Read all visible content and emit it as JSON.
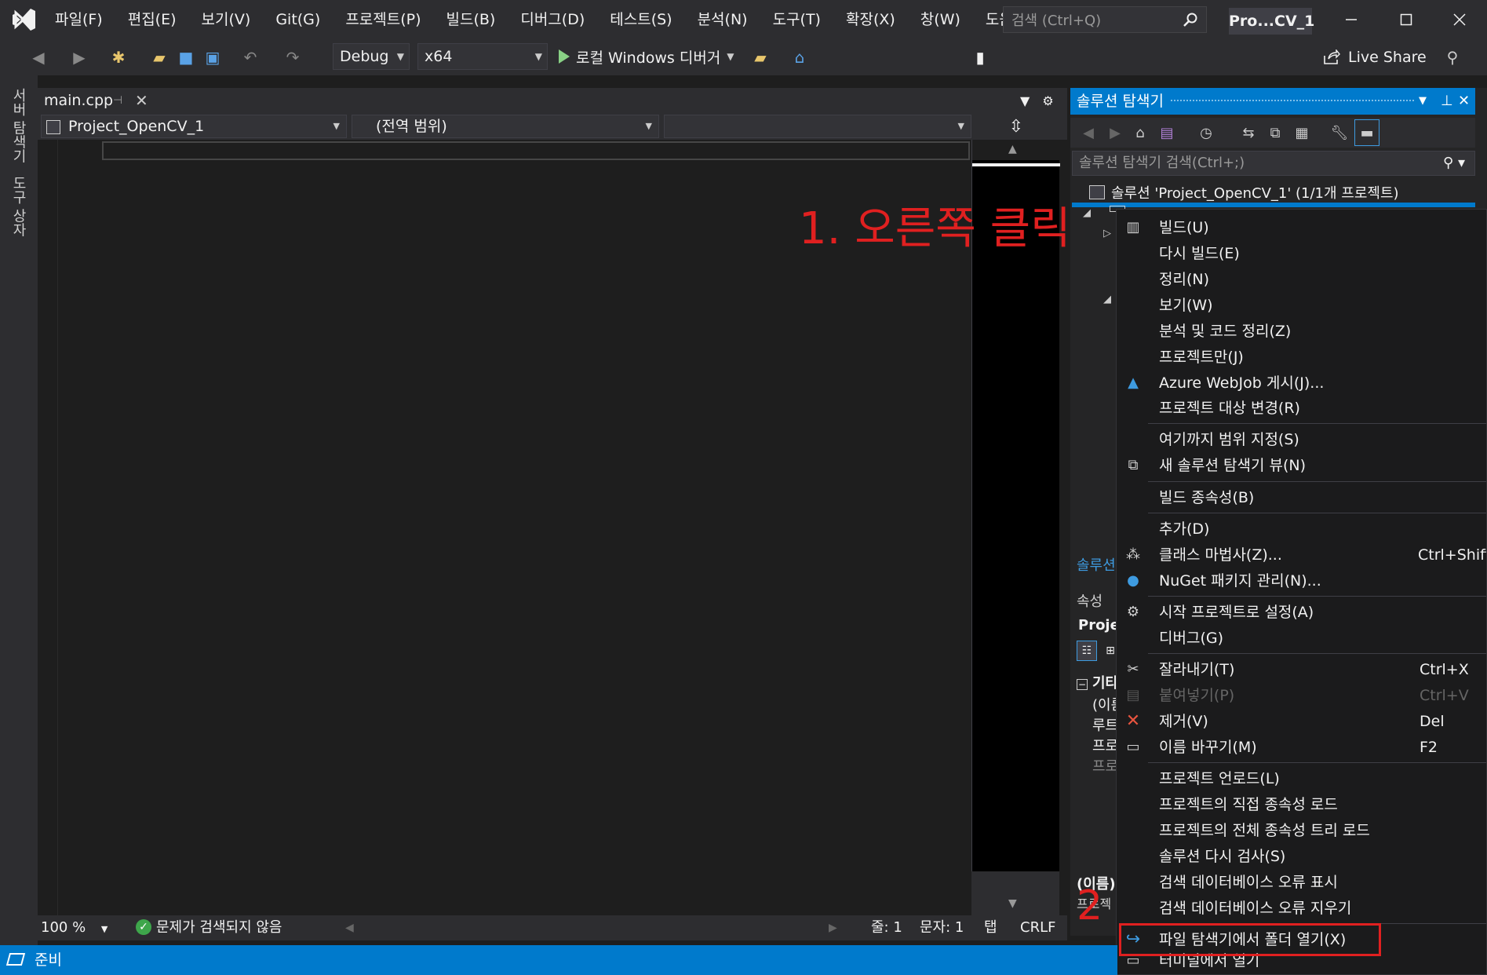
{
  "menubar": {
    "items": [
      "파일(F)",
      "편집(E)",
      "보기(V)",
      "Git(G)",
      "프로젝트(P)",
      "빌드(B)",
      "디버그(D)",
      "테스트(S)",
      "분석(N)",
      "도구(T)",
      "확장(X)",
      "창(W)",
      "도움말(H)"
    ],
    "search_placeholder": "검색 (Ctrl+Q)",
    "title_badge": "Pro...CV_1"
  },
  "toolbar": {
    "config": "Debug",
    "platform": "x64",
    "run_label": "로컬 Windows 디버거",
    "live_share": "Live Share"
  },
  "left_strip": {
    "tabs": [
      "서버 탐색기",
      "도구 상자"
    ]
  },
  "editor": {
    "tab_name": "main.cpp",
    "project_combo": "Project_OpenCV_1",
    "scope_combo": "(전역 범위)",
    "member_combo": ""
  },
  "editor_status": {
    "zoom": "100 %",
    "issues": "문제가 검색되지 않음",
    "line": "줄: 1",
    "col": "문자: 1",
    "indent": "탭",
    "eol": "CRLF"
  },
  "annotations": {
    "step1": "1. 오른쪽 클릭",
    "step2": "2"
  },
  "solution_explorer": {
    "title": "솔루션 탐색기",
    "search_placeholder": "솔루션 탐색기 검색(Ctrl+;)",
    "solution_label": "솔루션 'Project_OpenCV_1' (1/1개 프로젝트)",
    "bottom_tab": "솔루션"
  },
  "properties": {
    "title": "속성",
    "object": "Projec",
    "category": "기타",
    "rows": [
      "(이름",
      "루트",
      "프로",
      "프로"
    ],
    "bottom_name": "(이름)",
    "bottom_desc": "프로젝"
  },
  "context_menu": {
    "items": [
      {
        "label": "빌드(U)",
        "icon": "build-icon",
        "shortcut": ""
      },
      {
        "label": "다시 빌드(E)",
        "icon": "",
        "shortcut": ""
      },
      {
        "label": "정리(N)",
        "icon": "",
        "shortcut": ""
      },
      {
        "label": "보기(W)",
        "icon": "",
        "shortcut": ""
      },
      {
        "label": "분석 및 코드 정리(Z)",
        "icon": "",
        "shortcut": ""
      },
      {
        "label": "프로젝트만(J)",
        "icon": "",
        "shortcut": ""
      },
      {
        "label": "Azure WebJob 게시(J)...",
        "icon": "azure-icon",
        "shortcut": ""
      },
      {
        "label": "프로젝트 대상 변경(R)",
        "icon": "",
        "shortcut": ""
      },
      {
        "label": "여기까지 범위 지정(S)",
        "icon": "",
        "shortcut": ""
      },
      {
        "label": "새 솔루션 탐색기 뷰(N)",
        "icon": "new-view-icon",
        "shortcut": ""
      },
      {
        "label": "빌드 종속성(B)",
        "icon": "",
        "shortcut": ""
      },
      {
        "label": "추가(D)",
        "icon": "",
        "shortcut": ""
      },
      {
        "label": "클래스 마법사(Z)...",
        "icon": "class-wizard-icon",
        "shortcut": "Ctrl+Shift+"
      },
      {
        "label": "NuGet 패키지 관리(N)...",
        "icon": "nuget-icon",
        "shortcut": ""
      },
      {
        "label": "시작 프로젝트로 설정(A)",
        "icon": "gear-icon",
        "shortcut": ""
      },
      {
        "label": "디버그(G)",
        "icon": "",
        "shortcut": ""
      },
      {
        "label": "잘라내기(T)",
        "icon": "scissors-icon",
        "shortcut": "Ctrl+X"
      },
      {
        "label": "붙여넣기(P)",
        "icon": "paste-icon",
        "shortcut": "Ctrl+V"
      },
      {
        "label": "제거(V)",
        "icon": "remove-icon",
        "shortcut": "Del"
      },
      {
        "label": "이름 바꾸기(M)",
        "icon": "rename-icon",
        "shortcut": "F2"
      },
      {
        "label": "프로젝트 언로드(L)",
        "icon": "",
        "shortcut": ""
      },
      {
        "label": "프로젝트의 직접 종속성 로드",
        "icon": "",
        "shortcut": ""
      },
      {
        "label": "프로젝트의 전체 종속성 트리 로드",
        "icon": "",
        "shortcut": ""
      },
      {
        "label": "솔루션 다시 검사(S)",
        "icon": "",
        "shortcut": ""
      },
      {
        "label": "검색 데이터베이스 오류 표시",
        "icon": "",
        "shortcut": ""
      },
      {
        "label": "검색 데이터베이스 오류 지우기",
        "icon": "",
        "shortcut": ""
      },
      {
        "label": "파일 탐색기에서 폴더 열기(X)",
        "icon": "open-folder-arrow-icon",
        "shortcut": ""
      },
      {
        "label": "터미널에서 열기",
        "icon": "terminal-icon",
        "shortcut": ""
      }
    ]
  },
  "statusbar": {
    "text": "준비"
  },
  "colors": {
    "accent": "#007acc",
    "annotation": "#e02020"
  }
}
